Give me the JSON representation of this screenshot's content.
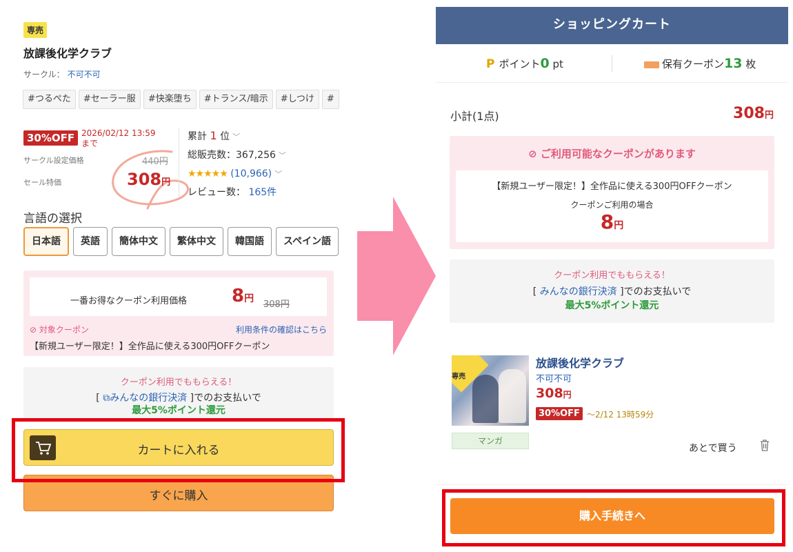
{
  "left": {
    "badge": "専売",
    "title": "放課後化学クラブ",
    "circle_label": "サークル：",
    "circle_name": "不可不可",
    "tags": [
      "#つるぺた",
      "#セーラー服",
      "#快楽堕ち",
      "#トランス/暗示",
      "#しつけ",
      "#"
    ],
    "discount_badge": "30%OFF",
    "sale_until_date": "2026/02/12 13:59",
    "sale_until_suffix": "まで",
    "set_price_label": "サークル設定価格",
    "set_price": "440円",
    "sale_price_label": "セール特価",
    "sale_price_num": "308",
    "yen": "円",
    "rank_prefix": "累計",
    "rank_num": "1",
    "rank_suffix": "位",
    "sales_text": "総販売数：367,256",
    "stars": "★★★★★",
    "rating_count": "(10,966)",
    "review_label": "レビュー数：",
    "review_count": "165件",
    "lang_title": "言語の選択",
    "languages": [
      "日本語",
      "英語",
      "簡体中文",
      "繁体中文",
      "韓国語",
      "スペイン語"
    ],
    "coupon_label": "一番お得なクーポン利用価格",
    "coupon_price_num": "8",
    "coupon_strike": "308円",
    "target_coupon": "対象クーポン",
    "terms_link": "利用条件の確認はこちら",
    "coupon_name": "【新規ユーザー限定！】全作品に使える300円OFFクーポン",
    "pay_top": "クーポン利用でももらえる！",
    "pay_line_open": "[",
    "pay_bank": "みんなの銀行決済",
    "pay_line_close": "]でのお支払いで",
    "pay_green": "最大5%ポイント還元",
    "cart_button": "カートに入れる",
    "buy_button": "すぐに購入"
  },
  "right": {
    "header": "ショッピングカート",
    "points_label": "ポイント",
    "points_value": "0",
    "points_unit": "pt",
    "coupons_label": "保有クーポン",
    "coupons_value": "13",
    "coupons_unit": "枚",
    "subtotal_label": "小計(1点)",
    "subtotal_num": "308",
    "yen": "円",
    "avail_title": "ご利用可能なクーポンがあります",
    "avail_name": "【新規ユーザー限定！】全作品に使える300円OFFクーポン",
    "avail_when": "クーポンご利用の場合",
    "avail_price_num": "8",
    "pay_top": "クーポン利用でももらえる！",
    "pay_line_open": "[",
    "pay_bank": "みんなの銀行決済",
    "pay_line_close": "]でのお支払いで",
    "pay_green": "最大5%ポイント還元",
    "item_badge": "専売",
    "item_title": "放課後化学クラブ",
    "item_circle": "不可不可",
    "item_price_num": "308",
    "item_off": "30%OFF",
    "item_until": "～2/12 13時59分",
    "genre": "マンガ",
    "later": "あとで買う",
    "proceed_button": "購入手続きへ"
  },
  "colors": {
    "header_blue": "#4a6591",
    "price_red": "#c62828",
    "highlight_red": "#e60012",
    "cart_yellow": "#f9d85c",
    "buy_orange": "#f9a54d",
    "proceed_orange": "#f78a24",
    "arrow_pink": "#fa8fab",
    "green": "#2e9c3c"
  }
}
